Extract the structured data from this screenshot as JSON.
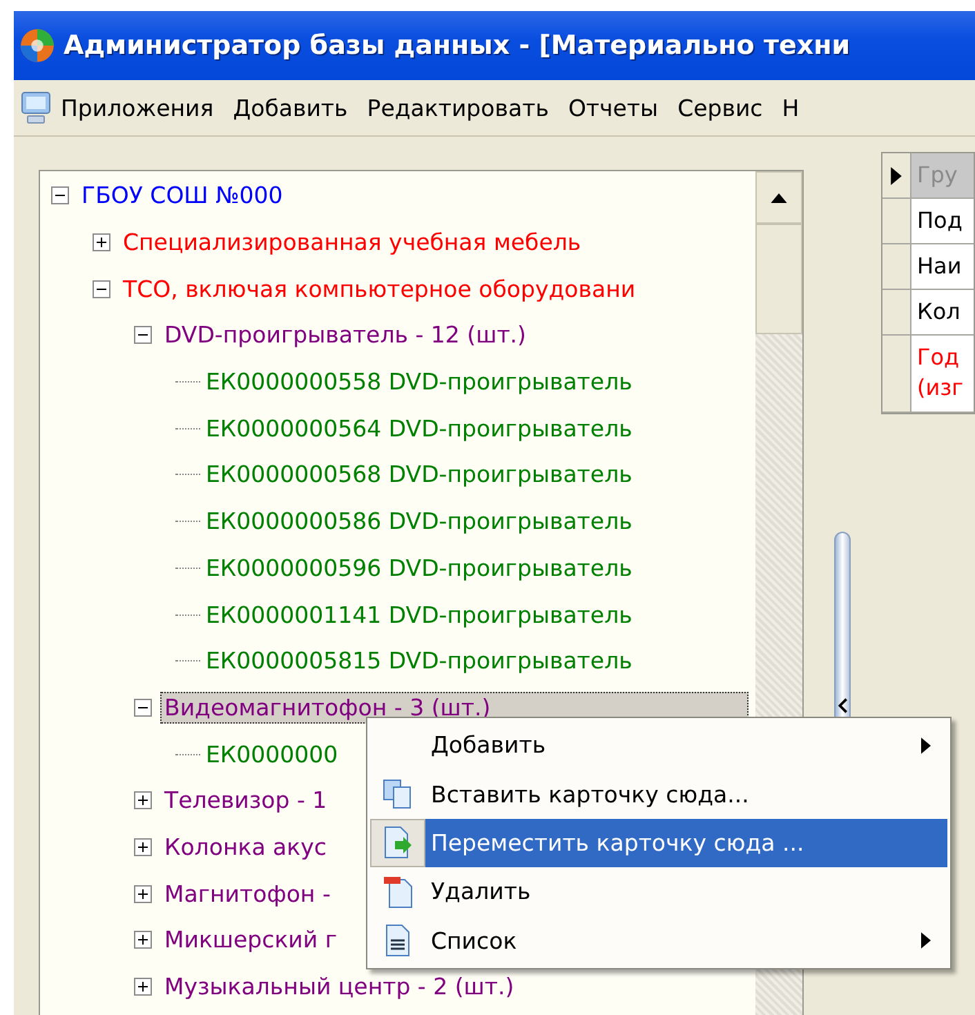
{
  "window": {
    "title": "Администратор базы данных - [Материально техни"
  },
  "menu_bar": [
    "Приложения",
    "Добавить",
    "Редактировать",
    "Отчеты",
    "Сервис",
    "Н"
  ],
  "tree": {
    "items": [
      {
        "label": "ГБОУ СОШ №000",
        "color": "#0000ff",
        "expanded": true,
        "selected": false,
        "children": [
          {
            "label": "Специализированная учебная мебель",
            "color": "#ff0000",
            "expanded": false,
            "selected": false
          },
          {
            "label": "ТСО, включая компьютерное оборудовани",
            "color": "#ff0000",
            "expanded": true,
            "selected": false,
            "children": [
              {
                "label": "DVD-проигрыватель - 12 (шт.)",
                "color": "#800080",
                "expanded": true,
                "selected": false,
                "children": [
                  {
                    "label": "ЕК0000000558 DVD-проигрыватель",
                    "color": "#008000",
                    "selected": false
                  },
                  {
                    "label": "ЕК0000000564 DVD-проигрыватель",
                    "color": "#008000",
                    "selected": false
                  },
                  {
                    "label": "ЕК0000000568 DVD-проигрыватель",
                    "color": "#008000",
                    "selected": false
                  },
                  {
                    "label": "ЕК0000000586 DVD-проигрыватель",
                    "color": "#008000",
                    "selected": false
                  },
                  {
                    "label": "ЕК0000000596 DVD-проигрыватель",
                    "color": "#008000",
                    "selected": false
                  },
                  {
                    "label": "ЕК0000001141 DVD-проигрыватель",
                    "color": "#008000",
                    "selected": false
                  },
                  {
                    "label": "ЕК0000005815 DVD-проигрыватель",
                    "color": "#008000",
                    "selected": false
                  }
                ]
              },
              {
                "label": "Видеомагнитофон - 3 (шт.)",
                "color": "#800080",
                "expanded": true,
                "selected": true,
                "children": [
                  {
                    "label": "ЕК0000000",
                    "color": "#008000",
                    "selected": false
                  }
                ]
              },
              {
                "label": "Телевизор - 1",
                "color": "#800080",
                "expanded": false,
                "selected": false
              },
              {
                "label": "Колонка акус",
                "color": "#800080",
                "expanded": false,
                "selected": false
              },
              {
                "label": "Магнитофон -",
                "color": "#800080",
                "expanded": false,
                "selected": false
              },
              {
                "label": "Микшерский г",
                "color": "#800080",
                "expanded": false,
                "selected": false
              },
              {
                "label": "Музыкальный центр - 2 (шт.)",
                "color": "#800080",
                "expanded": false,
                "selected": false
              }
            ]
          }
        ]
      }
    ]
  },
  "grid": {
    "rows": [
      {
        "lines": [
          "Гру"
        ],
        "selected": true,
        "kind": "header"
      },
      {
        "lines": [
          "Под"
        ],
        "selected": false,
        "kind": "normal"
      },
      {
        "lines": [
          "Наи"
        ],
        "selected": false,
        "kind": "normal"
      },
      {
        "lines": [
          "Кол"
        ],
        "selected": false,
        "kind": "normal"
      },
      {
        "lines": [
          "Год",
          "(изг"
        ],
        "selected": false,
        "kind": "required"
      }
    ]
  },
  "context_menu": {
    "items": [
      {
        "label": "Добавить",
        "submenu": true,
        "selected": false
      },
      {
        "label": "Вставить карточку сюда...",
        "submenu": false,
        "selected": false
      },
      {
        "label": "Переместить карточку сюда ...",
        "submenu": false,
        "selected": true
      },
      {
        "label": "Удалить",
        "submenu": false,
        "selected": false
      },
      {
        "label": "Список",
        "submenu": true,
        "selected": false
      }
    ]
  }
}
